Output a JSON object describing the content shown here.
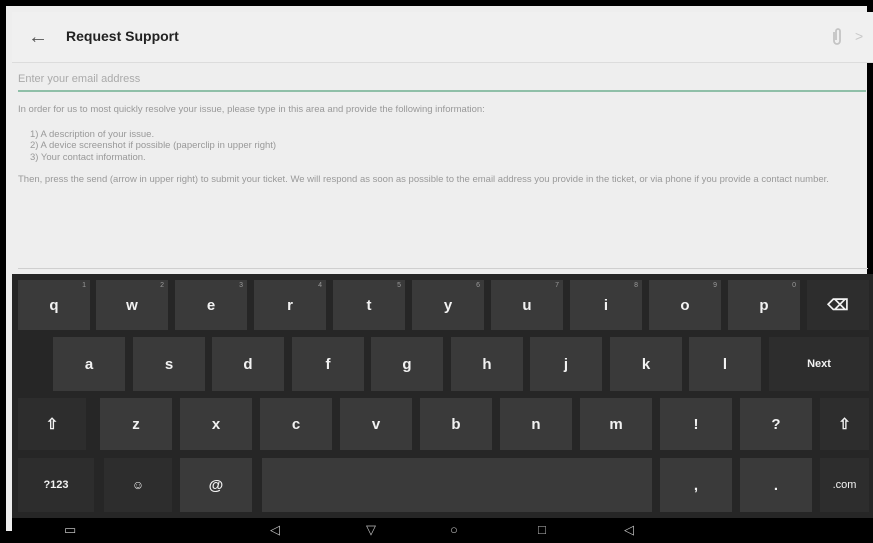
{
  "header": {
    "title": "Request Support",
    "back_icon": "back-arrow-icon",
    "clip_icon": "paperclip-icon",
    "send_icon": "send-arrow-icon",
    "send_glyph": ">"
  },
  "email": {
    "placeholder": "Enter your email address",
    "value": ""
  },
  "message": {
    "intro": "In order for us to most quickly resolve your issue, please type in this area and provide the following information:",
    "items": [
      "1) A description of your issue.",
      "2) A device screenshot if possible (paperclip in upper right)",
      "3) Your contact information."
    ],
    "outro": "Then, press the send (arrow in upper right) to submit your ticket. We will respond as soon as possible to the email address you provide in the ticket, or via phone if you provide a contact number."
  },
  "keyboard": {
    "row1": [
      {
        "label": "q",
        "hint": "1"
      },
      {
        "label": "w",
        "hint": "2"
      },
      {
        "label": "e",
        "hint": "3"
      },
      {
        "label": "r",
        "hint": "4"
      },
      {
        "label": "t",
        "hint": "5"
      },
      {
        "label": "y",
        "hint": "6"
      },
      {
        "label": "u",
        "hint": "7"
      },
      {
        "label": "i",
        "hint": "8"
      },
      {
        "label": "o",
        "hint": "9"
      },
      {
        "label": "p",
        "hint": "0"
      }
    ],
    "backspace_glyph": "⌫",
    "row2": [
      "a",
      "s",
      "d",
      "f",
      "g",
      "h",
      "j",
      "k",
      "l"
    ],
    "next_label": "Next",
    "shift_glyph": "⇧",
    "row3": [
      "z",
      "x",
      "c",
      "v",
      "b",
      "n",
      "m",
      "!",
      "?"
    ],
    "symbols_label": "?123",
    "emoji_glyph": "☺",
    "at_label": "@",
    "comma_label": ",",
    "period_label": ".",
    "com_label": ".com"
  },
  "navbar": {
    "screenshot_glyph": "▭",
    "volume_down_glyph": "◁",
    "back_glyph": "▽",
    "home_glyph": "○",
    "recents_glyph": "□",
    "volume_up_glyph": "◁"
  }
}
